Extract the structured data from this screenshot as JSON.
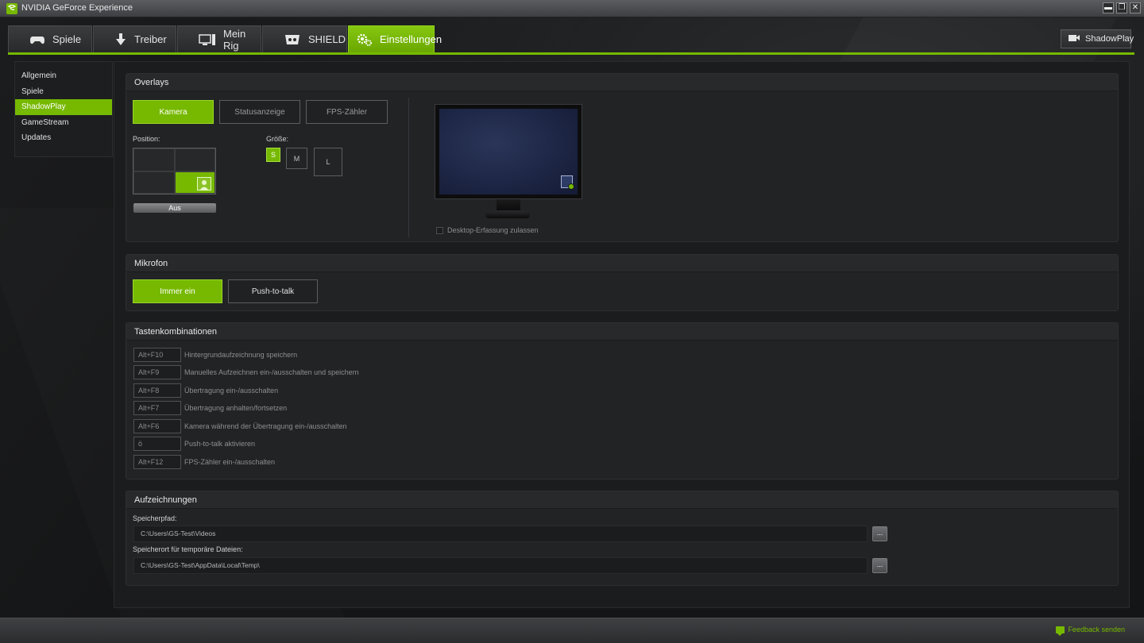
{
  "window": {
    "title": "NVIDIA GeForce Experience",
    "controls": [
      "▬",
      "❐",
      "✕"
    ]
  },
  "tabs": [
    {
      "label": "Spiele",
      "icon": "gamepad-icon"
    },
    {
      "label": "Treiber",
      "icon": "driver-icon"
    },
    {
      "label": "Mein Rig",
      "icon": "rig-icon"
    },
    {
      "label": "SHIELD",
      "icon": "shield-icon"
    },
    {
      "label": "Einstellungen",
      "icon": "gear-icon",
      "active": true
    }
  ],
  "shadowplay_button": {
    "label": "ShadowPlay",
    "icon": "camera-icon"
  },
  "sidebar": {
    "items": [
      {
        "label": "Allgemein"
      },
      {
        "label": "Spiele"
      },
      {
        "label": "ShadowPlay",
        "active": true
      },
      {
        "label": "GameStream"
      },
      {
        "label": "Updates"
      }
    ]
  },
  "overlays": {
    "title": "Overlays",
    "buttons": [
      "Kamera",
      "Statusanzeige",
      "FPS-Zähler"
    ],
    "active_button": "Kamera",
    "position_label": "Position:",
    "position_off": "Aus",
    "size_label": "Größe:",
    "sizes": [
      "S",
      "M",
      "L"
    ],
    "active_size": "S",
    "desktop_capture_label": "Desktop-Erfassung zulassen",
    "desktop_capture_checked": false
  },
  "microphone": {
    "title": "Mikrofon",
    "buttons": [
      "Immer ein",
      "Push-to-talk"
    ],
    "active_button": "Immer ein"
  },
  "hotkeys": {
    "title": "Tastenkombinationen",
    "rows": [
      {
        "key": "Alt+F10",
        "desc": "Hintergrundaufzeichnung speichern"
      },
      {
        "key": "Alt+F9",
        "desc": "Manuelles Aufzeichnen ein-/ausschalten und speichern"
      },
      {
        "key": "Alt+F8",
        "desc": "Übertragung ein-/ausschalten"
      },
      {
        "key": "Alt+F7",
        "desc": "Übertragung anhalten/fortsetzen"
      },
      {
        "key": "Alt+F6",
        "desc": "Kamera während der Übertragung ein-/ausschalten"
      },
      {
        "key": "ö",
        "desc": "Push-to-talk aktivieren"
      },
      {
        "key": "Alt+F12",
        "desc": "FPS-Zähler ein-/ausschalten"
      }
    ]
  },
  "recordings": {
    "title": "Aufzeichnungen",
    "save_path_label": "Speicherpfad:",
    "save_path_value": "C:\\Users\\GS-Test\\Videos",
    "temp_path_label": "Speicherort für temporäre Dateien:",
    "temp_path_value": "C:\\Users\\GS-Test\\AppData\\Local\\Temp\\",
    "browse_label": "..."
  },
  "footer": {
    "feedback_label": "Feedback senden"
  },
  "colors": {
    "accent": "#76b900",
    "background": "#131415",
    "panel": "#222325"
  }
}
